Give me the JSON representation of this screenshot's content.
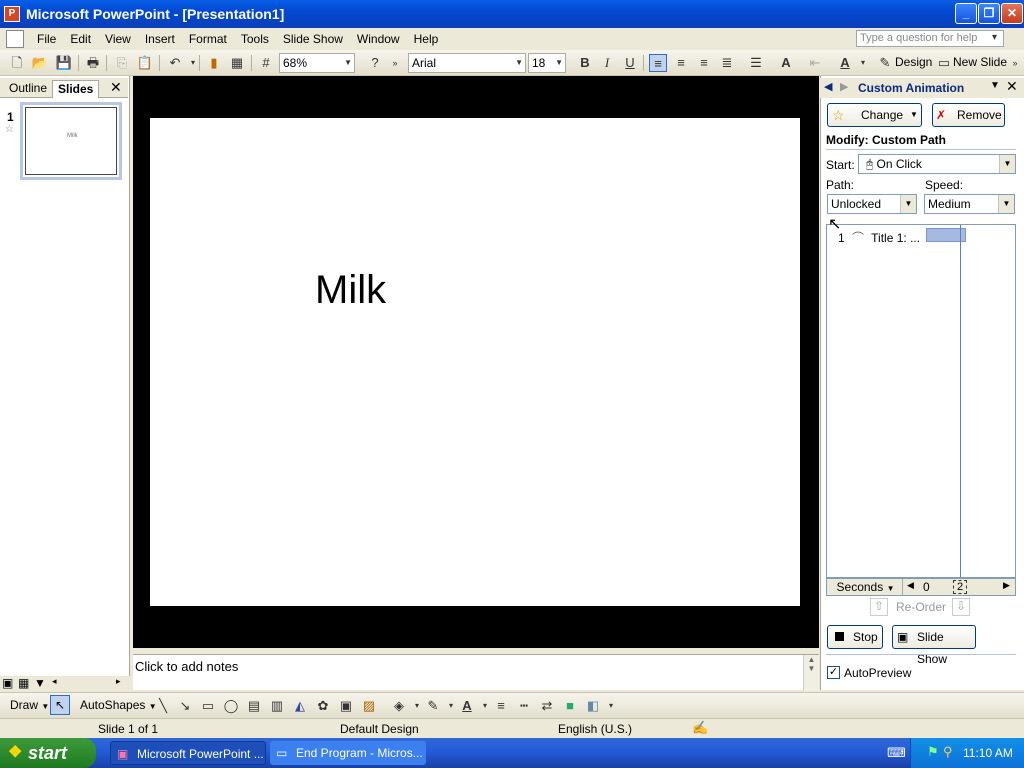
{
  "window": {
    "title": "Microsoft PowerPoint - [Presentation1]",
    "min_glyph": "_",
    "max_glyph": "❐",
    "close_glyph": "✕"
  },
  "menubar": {
    "items": [
      "File",
      "Edit",
      "View",
      "Insert",
      "Format",
      "Tools",
      "Slide Show",
      "Window",
      "Help"
    ],
    "help_placeholder": "Type a question for help"
  },
  "toolbar": {
    "zoom": "68%",
    "font": "Arial",
    "font_size": "18",
    "bold": "B",
    "italic": "I",
    "underline": "U",
    "design_label": "Design",
    "new_slide_label": "New Slide"
  },
  "leftpane": {
    "tabs": [
      "Outline",
      "Slides"
    ],
    "selected_tab": "Slides",
    "slide_number": "1",
    "thumb_text": "Milk"
  },
  "slide": {
    "title": "Milk"
  },
  "notes": {
    "placeholder": "Click to add notes"
  },
  "taskpane": {
    "title": "Custom Animation",
    "change_label": "Change",
    "remove_label": "Remove",
    "section_title": "Modify: Custom Path",
    "start_label": "Start:",
    "start_value": "On Click",
    "path_label": "Path:",
    "path_value": "Unlocked",
    "speed_label": "Speed:",
    "speed_value": "Medium",
    "anim_item_number": "1",
    "anim_item_label": "Title 1: ...",
    "timeline_units": "Seconds",
    "timeline_start": "0",
    "timeline_next": "2",
    "reorder_label": "Re-Order",
    "stop_label": "Stop",
    "slideshow_label": "Slide Show",
    "autopreview_label": "AutoPreview",
    "autopreview_checked": true
  },
  "drawbar": {
    "draw_label": "Draw",
    "autoshapes_label": "AutoShapes"
  },
  "statusbar": {
    "slide_info": "Slide 1 of 1",
    "design": "Default Design",
    "language": "English (U.S.)"
  },
  "taskbar": {
    "start_label": "start",
    "items": [
      "Microsoft PowerPoint ...",
      "End Program - Micros..."
    ],
    "clock": "11:10 AM"
  },
  "colors": {
    "titlebar": "#0A5FE6",
    "taskbar": "#245DDB",
    "start": "#2E8B2E",
    "taskpane_title": "#0B2A82"
  }
}
